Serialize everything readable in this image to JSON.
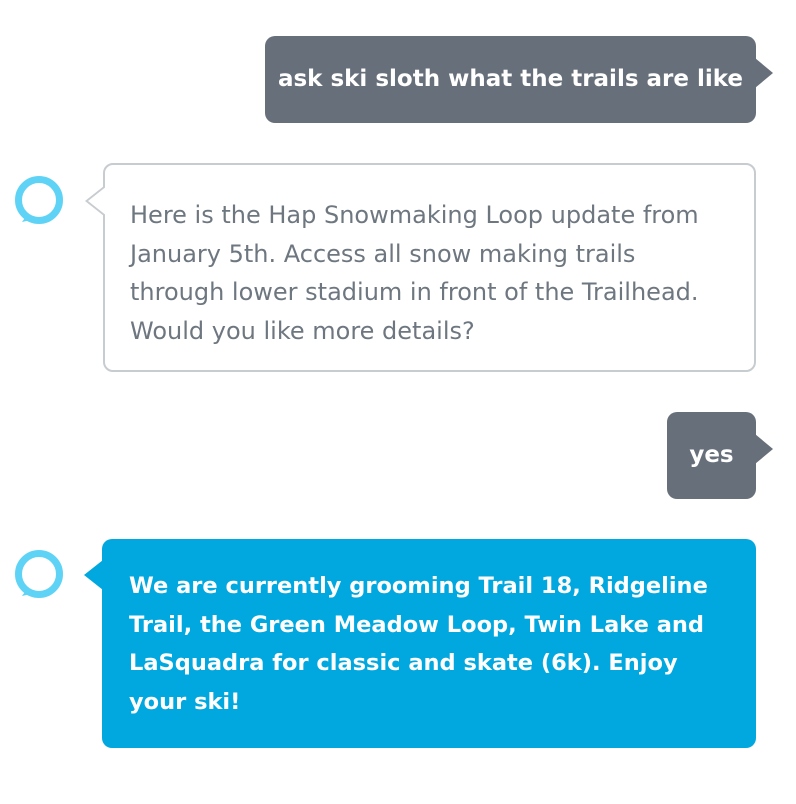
{
  "conversation": {
    "messages": [
      {
        "role": "user",
        "text": "ask ski sloth what the trails are like"
      },
      {
        "role": "alexa",
        "text": "Here is the Hap Snowmaking Loop update from January 5th. Access all snow making trails through lower stadium in front of the Trailhead. Would you like more details?"
      },
      {
        "role": "user",
        "text": "yes"
      },
      {
        "role": "alexa",
        "text": "We are currently grooming Trail 18, Ridgeline Trail, the Green Meadow Loop, Twin Lake and LaSquadra for classic and skate (6k). Enjoy your ski!"
      }
    ]
  },
  "icons": {
    "alexa_avatar": "alexa-ring-icon"
  },
  "colors": {
    "user_bubble": "#67707a",
    "alexa_bubble_border": "#c7ccd1",
    "alexa_text": "#6e7780",
    "alexa_highlight_bubble": "#00a8df",
    "alexa_ring": "#5fd3f5"
  }
}
